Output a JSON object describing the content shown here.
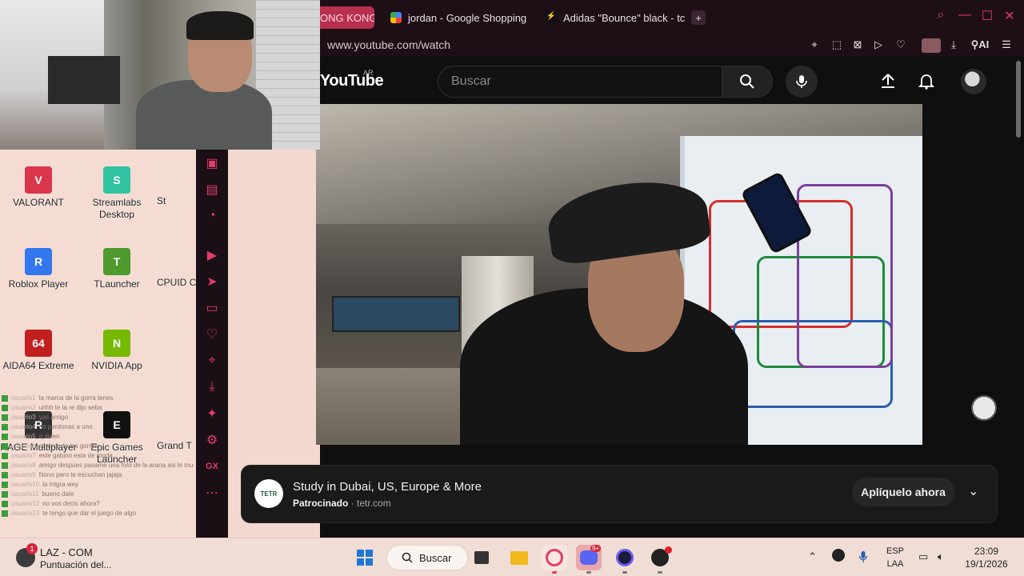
{
  "tabs": [
    {
      "label": "ONG KONG",
      "active": true
    },
    {
      "label": "jordan - Google Shopping",
      "active": false
    },
    {
      "label": "Adidas \"Bounce\" black - tc",
      "active": false
    }
  ],
  "browser": {
    "url": "www.youtube.com/watch",
    "ai_label": "AI",
    "accent": "#e33c6b"
  },
  "youtube": {
    "logo": "YouTube",
    "region": "AR",
    "search_placeholder": "Buscar"
  },
  "ad": {
    "logo_text": "TETR",
    "title": "Study in Dubai, US, Europe & More",
    "sponsored": "Patrocinado",
    "domain": "tetr.com",
    "cta": "Aplíquelo ahora"
  },
  "desktop": {
    "icons": [
      {
        "label": "VALORANT",
        "color": "#d9364b",
        "glyph": "V"
      },
      {
        "label": "Streamlabs Desktop",
        "color": "#31c3a2",
        "glyph": "S"
      },
      {
        "label": "Roblox Player",
        "color": "#3377ee",
        "glyph": "R"
      },
      {
        "label": "TLauncher",
        "color": "#4e9a2e",
        "glyph": "T"
      },
      {
        "label": "AIDA64 Extreme",
        "color": "#c21f1f",
        "glyph": "64"
      },
      {
        "label": "NVIDIA App",
        "color": "#76b900",
        "glyph": "N"
      },
      {
        "label": "RAGE Multiplayer",
        "color": "#333333",
        "glyph": "R"
      },
      {
        "label": "Epic Games Launcher",
        "color": "#111111",
        "glyph": "E"
      }
    ],
    "partial_labels": [
      "St",
      "CPUID C",
      "Grand T"
    ]
  },
  "chat": [
    {
      "user": "usuario1",
      "msg": "la marca de la gorra tenes"
    },
    {
      "user": "usuario2",
      "msg": "uhhh te la re dijo seba"
    },
    {
      "user": "usuario3",
      "msg": "yas amigo"
    },
    {
      "user": "usuario4",
      "msg": "no perdonas a uno"
    },
    {
      "user": "usuario5",
      "msg": "q dicen"
    },
    {
      "user": "usuario6",
      "msg": "el error de las gorras"
    },
    {
      "user": "usuario7",
      "msg": "este gabino esta de moda"
    },
    {
      "user": "usuario8",
      "msg": "amigo despues pasame una foto de la arana asi le muestro a mi hermana. no digas gilada que estoy aca con todos jsjsjsjs"
    },
    {
      "user": "usuario9",
      "msg": "Nono pero te escuchan jajaja"
    },
    {
      "user": "usuario10",
      "msg": "la migra wey"
    },
    {
      "user": "usuario11",
      "msg": "bueno dale"
    },
    {
      "user": "usuario12",
      "msg": "no vos decis ahora?"
    },
    {
      "user": "usuario13",
      "msg": "te tengo que dar el juego de algo"
    }
  ],
  "taskbar": {
    "weather_title": "LAZ - COM",
    "weather_sub": "Puntuación del...",
    "weather_badge": "1",
    "search_label": "Buscar",
    "lang_top": "ESP",
    "lang_bottom": "LAA",
    "time": "23:09",
    "date": "19/1/2026",
    "discord_badge": "9+"
  },
  "opera_sidebar": [
    "messenger-icon",
    "twitch-icon",
    "whatsapp-icon",
    "player-icon",
    "send-icon",
    "wallet-icon",
    "heart-icon",
    "pin-icon",
    "download-icon",
    "extensions-icon",
    "settings-icon",
    "gx-icon",
    "more-icon"
  ]
}
